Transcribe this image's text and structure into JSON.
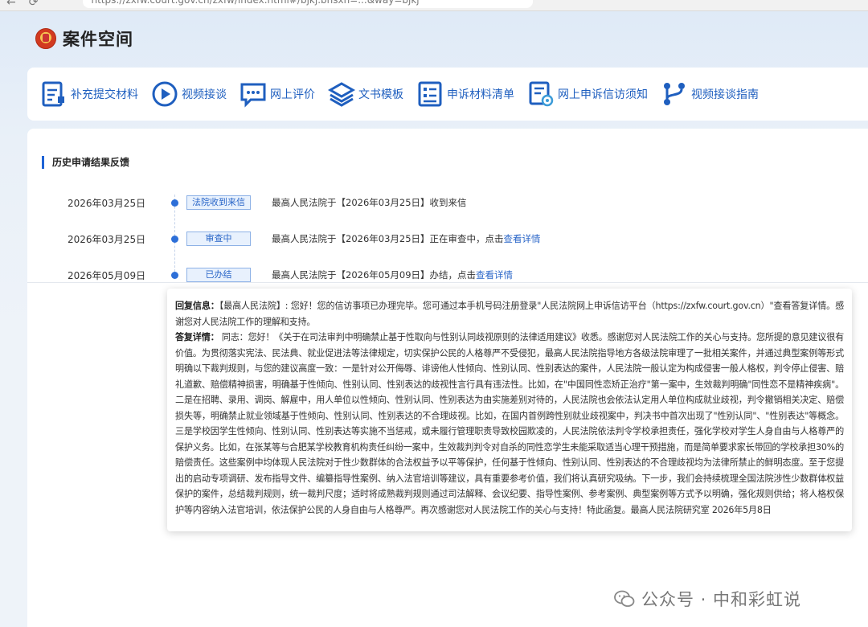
{
  "browser": {
    "url": "https://zxfw.court.gov.cn/zxfw/index.html#/bjkj.bhsxh=...&way=bjkj"
  },
  "app": {
    "title": "案件空间"
  },
  "toolbar": {
    "items": [
      {
        "label": "补充提交材料",
        "icon": "document-edit-icon"
      },
      {
        "label": "视频接谈",
        "icon": "play-circle-icon"
      },
      {
        "label": "网上评价",
        "icon": "chat-bubble-icon"
      },
      {
        "label": "文书模板",
        "icon": "layers-icon"
      },
      {
        "label": "申诉材料清单",
        "icon": "checklist-icon"
      },
      {
        "label": "网上申诉信访须知",
        "icon": "notice-doc-icon"
      },
      {
        "label": "视频接谈指南",
        "icon": "flow-guide-icon"
      }
    ]
  },
  "section": {
    "title": "历史申请结果反馈"
  },
  "timeline": [
    {
      "date": "2026年03月25日",
      "status": "法院收到来信",
      "text": "最高人民法院于【2026年03月25日】收到来信",
      "link": ""
    },
    {
      "date": "2026年03月25日",
      "status": "审查中",
      "text": "最高人民法院于【2026年03月25日】正在审查中，点击",
      "link": "查看详情"
    },
    {
      "date": "2026年05月09日",
      "status": "已办结",
      "text": "最高人民法院于【2026年05月09日】办结，点击",
      "link": "查看详情"
    }
  ],
  "reply": {
    "info_label": "回复信息：",
    "info_text": "【最高人民法院】:      您好！您的信访事项已办理完毕。您可通过本手机号码注册登录\"人民法院网上申诉信访平台（https://zxfw.court.gov.cn）\"查看答复详情。感谢您对人民法院工作的理解和支持。",
    "answer_label": "答复详情：",
    "answer_text": "      同志：您好！《关于在司法审判中明确禁止基于性取向与性别认同歧视原则的法律适用建议》收悉。感谢您对人民法院工作的关心与支持。您所提的意见建议很有价值。为贯彻落实宪法、民法典、就业促进法等法律规定，切实保护公民的人格尊严不受侵犯，最高人民法院指导地方各级法院审理了一批相关案件，并通过典型案例等形式明确以下裁判规则，与您的建议高度一致：一是针对公开侮辱、诽谤他人性倾向、性别认同、性别表达的案件，人民法院一般认定为构成侵害一般人格权，判令停止侵害、赔礼道歉、赔偿精神损害，明确基于性倾向、性别认同、性别表达的歧视性言行具有违法性。比如，在\"中国同性恋矫正治疗\"第一案中，生效裁判明确\"同性恋不是精神疾病\"。二是在招聘、录用、调岗、解雇中，用人单位以性倾向、性别认同、性别表达为由实施差别对待的，人民法院也会依法认定用人单位构成就业歧视，判令撤销相关决定、赔偿损失等，明确禁止就业领域基于性倾向、性别认同、性别表达的不合理歧视。比如，在国内首例跨性别就业歧视案中，判决书中首次出现了\"性别认同\"、\"性别表达\"等概念。三是学校因学生性倾向、性别认同、性别表达等实施不当惩戒，或未履行管理职责导致校园欺凌的，人民法院依法判令学校承担责任，强化学校对学生人身自由与人格尊严的保护义务。比如，在张某等与合肥某学校教育机构责任纠纷一案中，生效裁判判令对自杀的同性恋学生未能采取适当心理干预措施，而是简单要求家长带回的学校承担30%的赔偿责任。这些案例中均体现人民法院对于性少数群体的合法权益予以平等保护，任何基于性倾向、性别认同、性别表达的不合理歧视均为法律所禁止的鲜明态度。至于您提出的启动专项调研、发布指导文件、编纂指导性案例、纳入法官培训等建议，具有重要参考价值，我们将认真研究吸纳。下一步，我们会持续梳理全国法院涉性少数群体权益保护的案件，总结裁判规则，统一裁判尺度；适时将成熟裁判规则通过司法解释、会议纪要、指导性案例、参考案例、典型案例等方式予以明确，强化规则供给；将人格权保护等内容纳入法官培训，依法保护公民的人身自由与人格尊严。再次感谢您对人民法院工作的关心与支持！特此函复。最高人民法院研究室 2026年5月8日"
  },
  "watermark": {
    "text": "公众号 · 中和彩虹说",
    "icon": "wechat-icon"
  }
}
